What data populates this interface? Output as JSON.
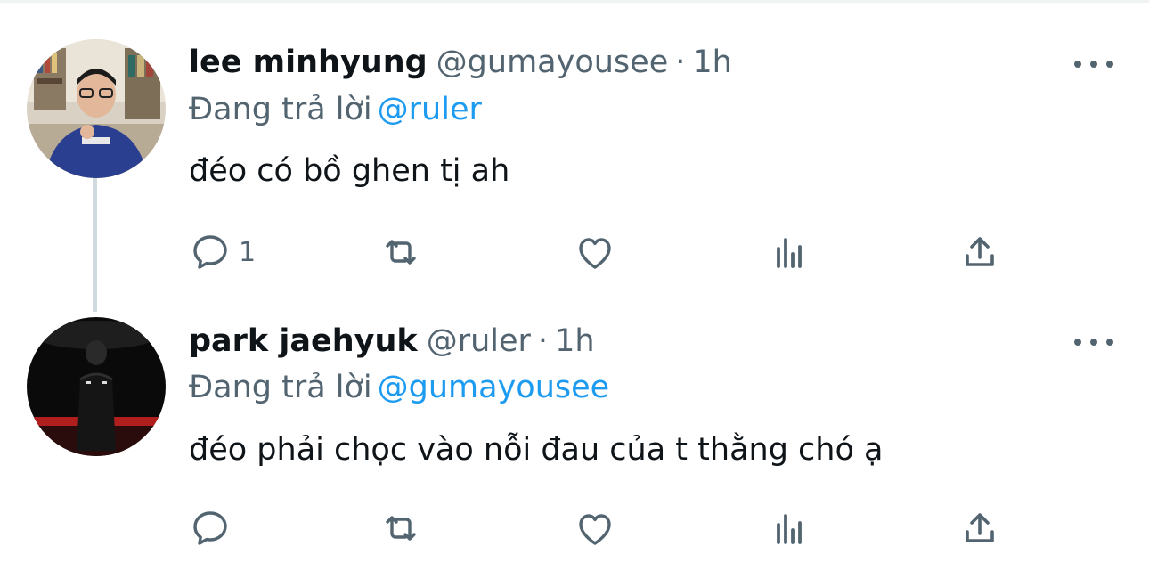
{
  "thread": {
    "tweets": [
      {
        "display_name": "lee minhyung",
        "handle": "@gumayousee",
        "separator": "·",
        "time": "1h",
        "reply_prefix": "Đang trả lời",
        "reply_to": "@ruler",
        "text": "đéo có bồ ghen tị ah",
        "reply_count": "1",
        "retweet_count": "",
        "like_count": ""
      },
      {
        "display_name": "park jaehyuk",
        "handle": "@ruler",
        "separator": "·",
        "time": "1h",
        "reply_prefix": "Đang trả lời",
        "reply_to": "@gumayousee",
        "text": "đéo phải chọc vào nỗi đau của t thằng chó ạ",
        "reply_count": "",
        "retweet_count": "",
        "like_count": ""
      }
    ]
  },
  "icons": {
    "more": "more-horizontal-icon",
    "reply": "reply-bubble-icon",
    "retweet": "retweet-icon",
    "like": "heart-icon",
    "views": "analytics-bars-icon",
    "share": "share-upload-icon"
  },
  "colors": {
    "text_primary": "#0f1419",
    "text_secondary": "#536471",
    "mention": "#1d9bf0",
    "thread_line": "#cfd9de"
  }
}
